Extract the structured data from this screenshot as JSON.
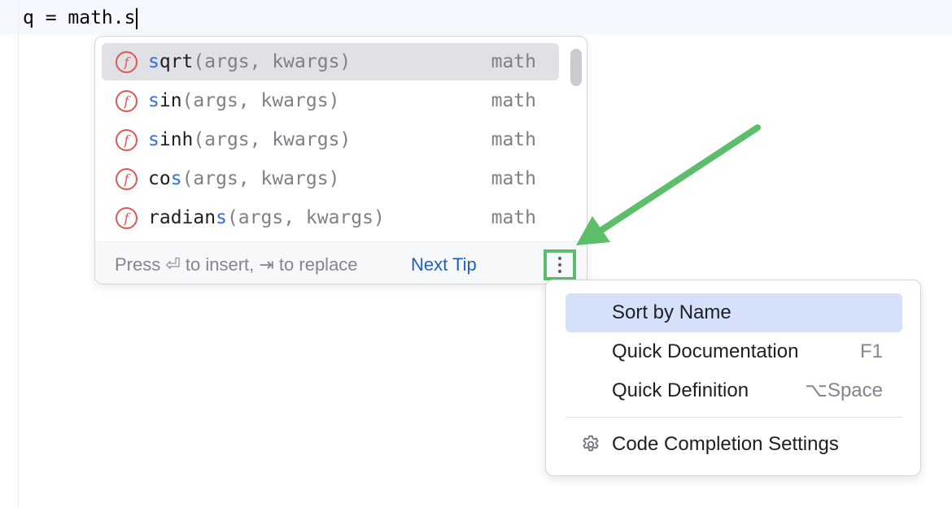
{
  "editor": {
    "code_line": "q = math.s"
  },
  "completion": {
    "items": [
      {
        "match": "s",
        "rest": "qrt",
        "params": "(args, kwargs)",
        "location": "math",
        "icon": "function-icon",
        "icon_glyph": "f"
      },
      {
        "match": "s",
        "rest": "in",
        "params": "(args, kwargs)",
        "location": "math",
        "icon": "function-icon",
        "icon_glyph": "f"
      },
      {
        "match": "s",
        "rest": "inh",
        "params": "(args, kwargs)",
        "location": "math",
        "icon": "function-icon",
        "icon_glyph": "f"
      },
      {
        "pre": "co",
        "match": "s",
        "rest": "",
        "params": "(args, kwargs)",
        "location": "math",
        "icon": "function-icon",
        "icon_glyph": "f"
      },
      {
        "pre": "radian",
        "match": "s",
        "rest": "",
        "params": "(args, kwargs)",
        "location": "math",
        "icon": "function-icon",
        "icon_glyph": "f"
      }
    ],
    "footer_hint": "Press ⏎ to insert, ⇥ to replace",
    "next_tip": "Next Tip",
    "more_icon": "more-vertical-icon"
  },
  "context_menu": {
    "items": [
      {
        "label": "Sort by Name",
        "shortcut": ""
      },
      {
        "label": "Quick Documentation",
        "shortcut": "F1"
      },
      {
        "label": "Quick Definition",
        "shortcut": "⌥Space"
      }
    ],
    "settings_label": "Code Completion Settings",
    "settings_icon": "gear-icon"
  },
  "colors": {
    "match_highlight": "#2f6fe0",
    "function_icon": "#e05555",
    "annotation_arrow": "#5cbd6a",
    "selected_menu": "#d5e0fb"
  }
}
